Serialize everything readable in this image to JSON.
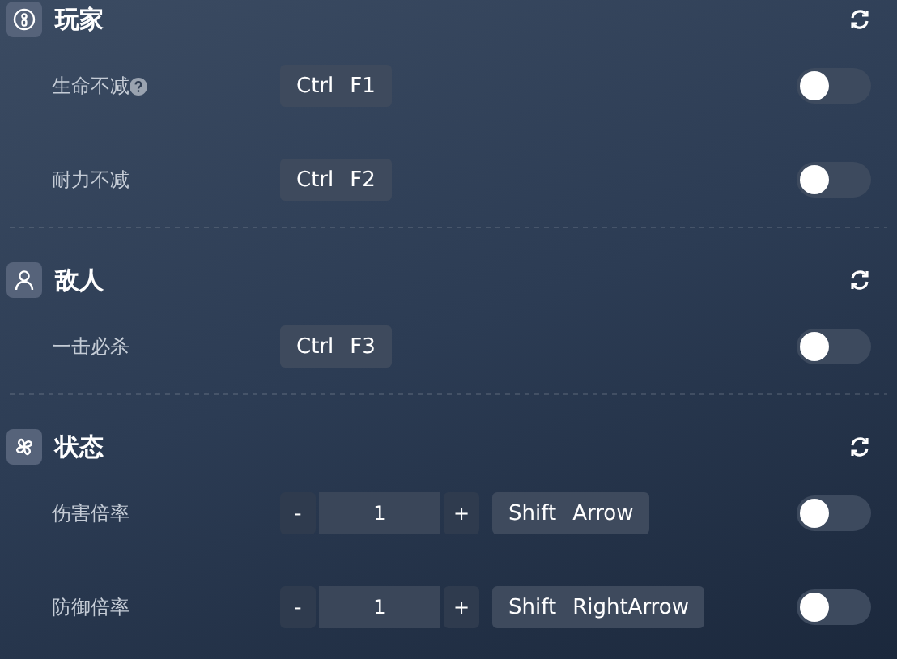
{
  "sections": [
    {
      "title": "玩家",
      "kind": "player",
      "rows": [
        {
          "label": "生命不减",
          "help": true,
          "hotkey": [
            "Ctrl",
            "F1"
          ],
          "on": false
        },
        {
          "label": "耐力不减",
          "help": false,
          "hotkey": [
            "Ctrl",
            "F2"
          ],
          "on": false
        }
      ]
    },
    {
      "title": "敌人",
      "kind": "enemy",
      "rows": [
        {
          "label": "一击必杀",
          "help": false,
          "hotkey": [
            "Ctrl",
            "F3"
          ],
          "on": false
        }
      ]
    },
    {
      "title": "状态",
      "kind": "status",
      "rows": [
        {
          "label": "伤害倍率",
          "help": false,
          "stepper": {
            "minus": "-",
            "value": "1",
            "plus": "+"
          },
          "hotkey": [
            "Shift",
            "Arrow"
          ],
          "on": false
        },
        {
          "label": "防御倍率",
          "help": false,
          "stepper": {
            "minus": "-",
            "value": "1",
            "plus": "+"
          },
          "hotkey": [
            "Shift",
            "RightArrow"
          ],
          "on": false
        }
      ]
    }
  ]
}
